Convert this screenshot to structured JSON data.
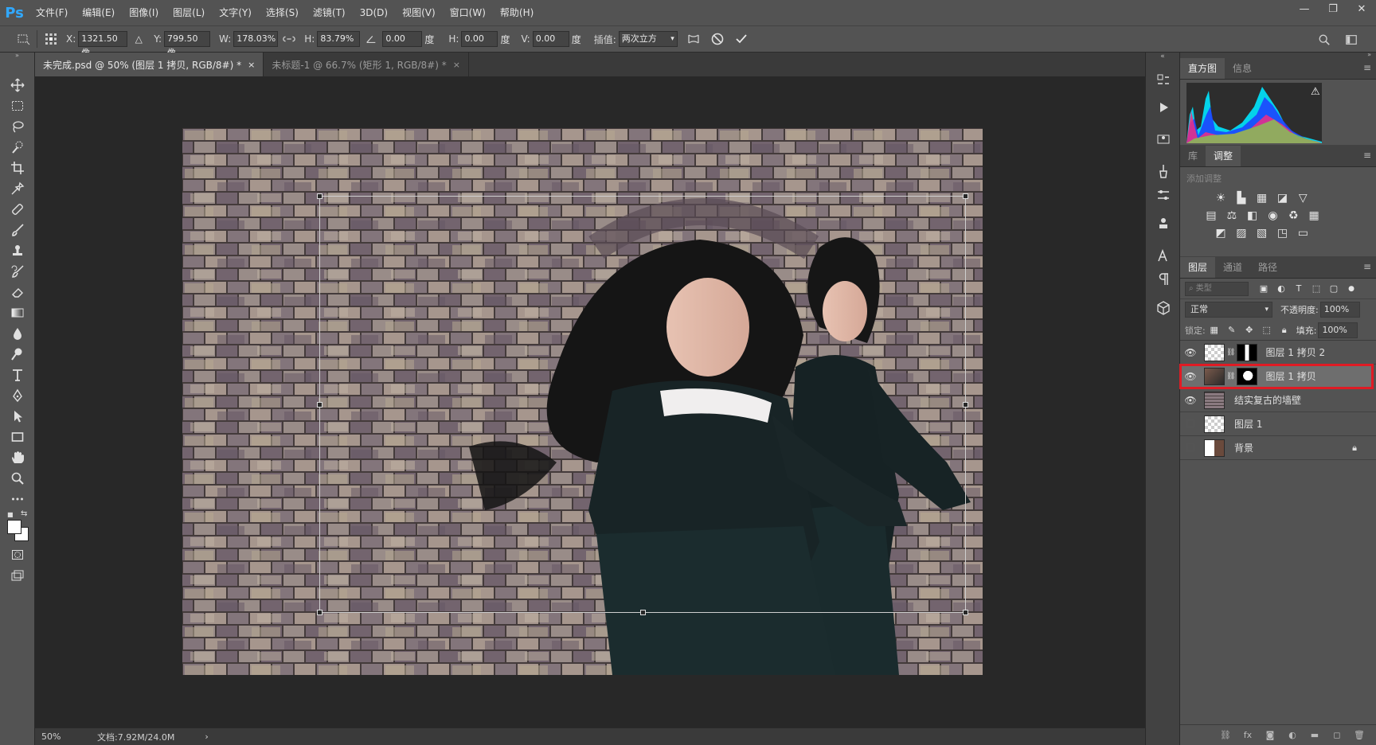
{
  "app": {
    "logo": "Ps"
  },
  "menu": [
    "文件(F)",
    "编辑(E)",
    "图像(I)",
    "图层(L)",
    "文字(Y)",
    "选择(S)",
    "滤镜(T)",
    "3D(D)",
    "视图(V)",
    "窗口(W)",
    "帮助(H)"
  ],
  "window_controls": {
    "minimize": "—",
    "restore": "❐",
    "close": "✕"
  },
  "options": {
    "x_label": "X:",
    "x_value": "1321.50 像",
    "y_label": "Y:",
    "y_value": "799.50 像",
    "w_label": "W:",
    "w_value": "178.03%",
    "h_label": "H:",
    "h_value": "83.79%",
    "angle_value": "0.00",
    "angle_unit": "度",
    "hskew_label": "H:",
    "hskew_value": "0.00",
    "hskew_unit": "度",
    "vskew_label": "V:",
    "vskew_value": "0.00",
    "vskew_unit": "度",
    "interp_label": "插值:",
    "interp_value": "两次立方"
  },
  "tabs": [
    {
      "label": "未完成.psd @ 50% (图层 1 拷贝, RGB/8#) *",
      "close": "×"
    },
    {
      "label": "未标题-1 @ 66.7% (矩形 1, RGB/8#) *",
      "close": "×"
    }
  ],
  "status": {
    "zoom": "50%",
    "doc": "文档:7.92M/24.0M",
    "arrow": "›"
  },
  "histogram_panel": {
    "tabs": [
      "直方图",
      "信息"
    ],
    "warning": "⚠"
  },
  "adjust_panel": {
    "tabs": [
      "库",
      "调整"
    ],
    "title": "添加调整"
  },
  "layers_panel": {
    "tabs": [
      "图层",
      "通道",
      "路径"
    ],
    "filter_placeholder": "类型",
    "blend_mode": "正常",
    "opacity_label": "不透明度:",
    "opacity_value": "100%",
    "lock_label": "锁定:",
    "fill_label": "填充:",
    "fill_value": "100%",
    "layers": [
      {
        "name": "图层 1 拷贝 2",
        "visible": true
      },
      {
        "name": "图层 1 拷贝",
        "visible": true,
        "selected": true
      },
      {
        "name": "结实复古的墙壁",
        "visible": true
      },
      {
        "name": "图层 1",
        "visible": false
      },
      {
        "name": "背景",
        "visible": false,
        "locked": true
      }
    ]
  },
  "colors": {
    "accent_red": "#e01b24",
    "ps_blue": "#31a8ff"
  }
}
